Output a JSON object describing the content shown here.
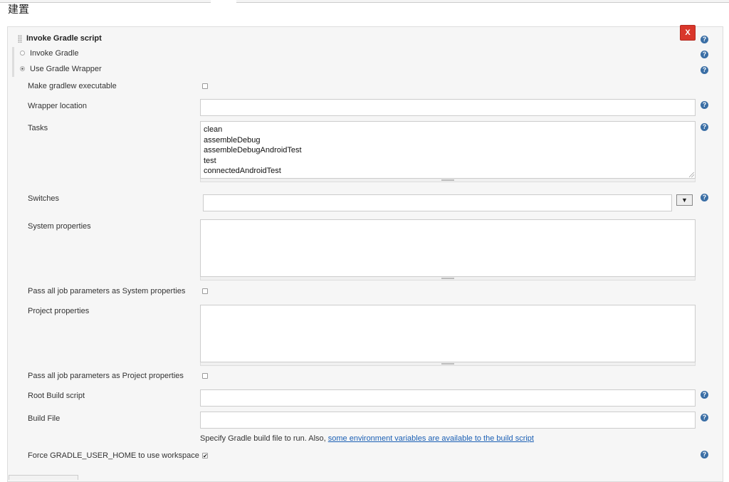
{
  "section": {
    "title": "建置"
  },
  "step": {
    "title": "Invoke Gradle script",
    "delete_label": "X",
    "help_glyph": "?"
  },
  "gradle_mode": {
    "options": [
      {
        "label": "Invoke Gradle",
        "selected": false
      },
      {
        "label": "Use Gradle Wrapper",
        "selected": true
      }
    ]
  },
  "fields": {
    "make_executable": {
      "label": "Make gradlew executable",
      "checked": false
    },
    "wrapper_location": {
      "label": "Wrapper location",
      "value": ""
    },
    "tasks": {
      "label": "Tasks",
      "lines": [
        "clean",
        "assembleDebug",
        "assembleDebugAndroidTest",
        "test",
        "connectedAndroidTest"
      ]
    },
    "switches": {
      "label": "Switches",
      "value": "",
      "dropdown_glyph": "▼"
    },
    "system_properties": {
      "label": "System properties",
      "value": ""
    },
    "pass_system": {
      "label": "Pass all job parameters as System properties",
      "checked": false
    },
    "project_properties": {
      "label": "Project properties",
      "value": ""
    },
    "pass_project": {
      "label": "Pass all job parameters as Project properties",
      "checked": false
    },
    "root_build_script": {
      "label": "Root Build script",
      "value": ""
    },
    "build_file": {
      "label": "Build File",
      "value": "",
      "hint_prefix": "Specify Gradle build file to run. Also, ",
      "hint_link": "some environment variables are available to the build script"
    },
    "force_home": {
      "label": "Force GRADLE_USER_HOME to use workspace",
      "checked": true,
      "check_glyph": "✔"
    }
  },
  "colors": {
    "delete": "#d9372b",
    "help": "#3a6ea5",
    "link": "#1a5fb4",
    "panel": "#f6f6f6"
  }
}
